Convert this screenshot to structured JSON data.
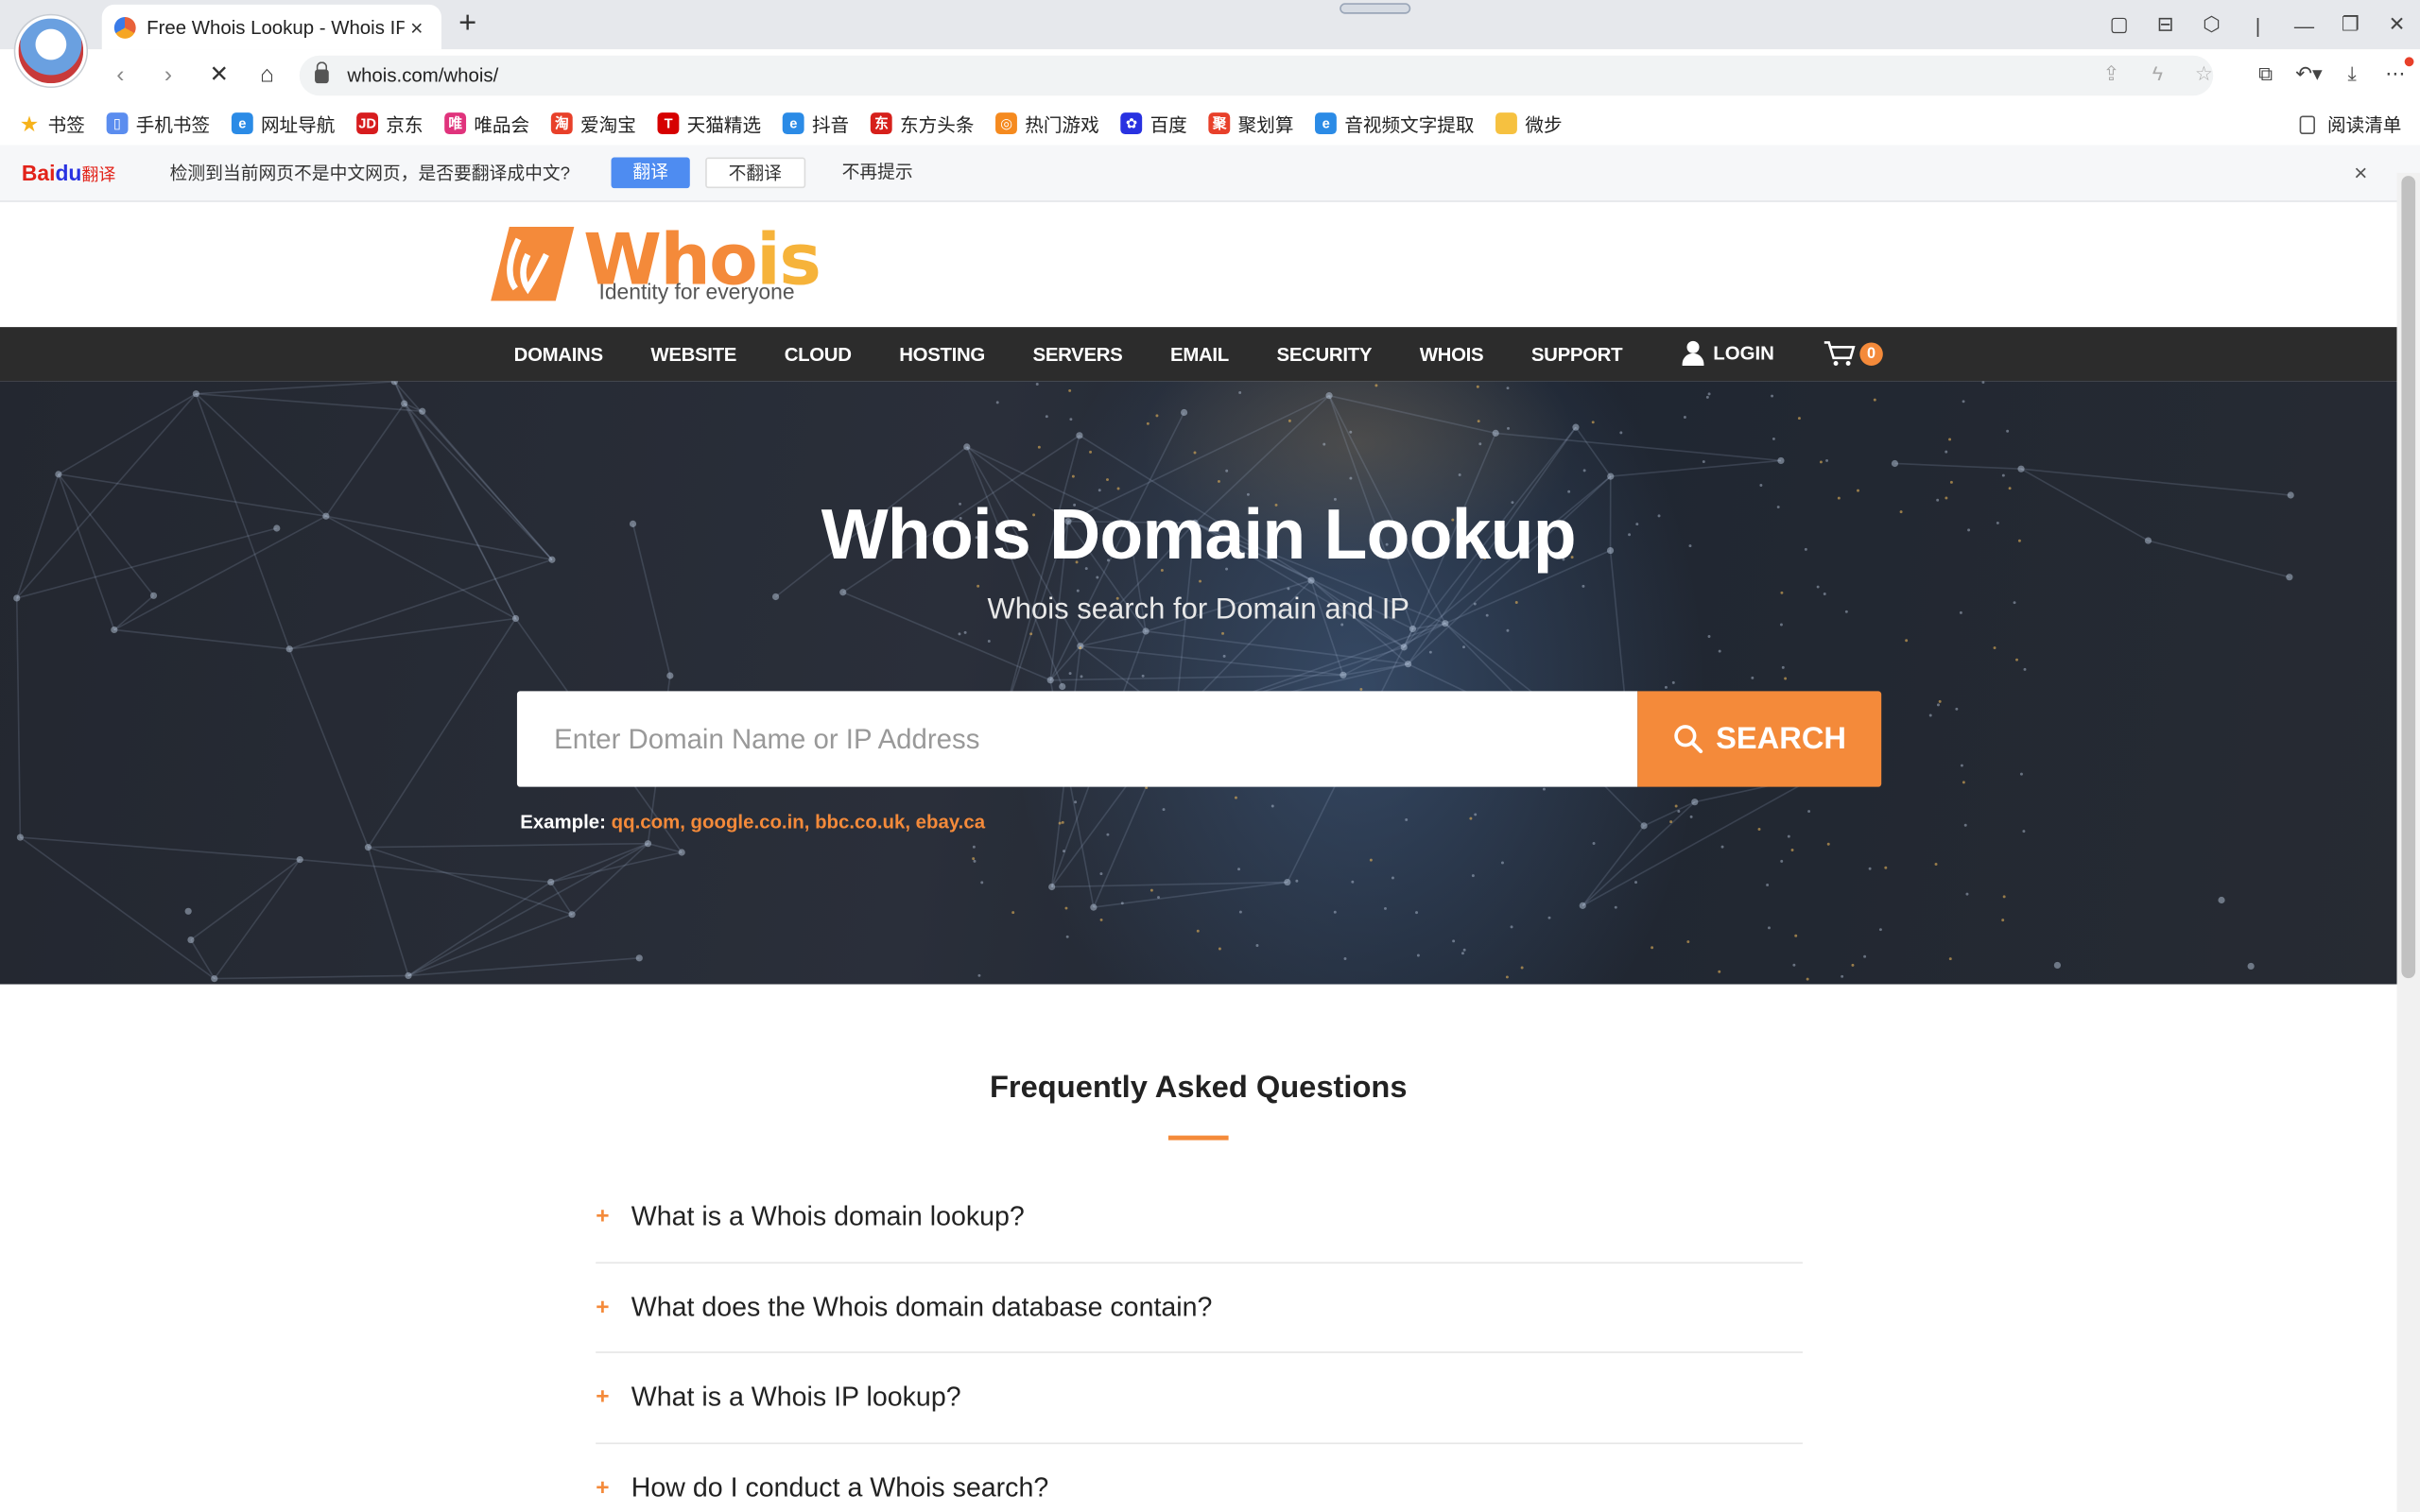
{
  "browser": {
    "tab_title": "Free Whois Lookup - Whois IP",
    "tab_close": "×",
    "new_tab": "+",
    "url": "whois.com/whois/",
    "window_controls": [
      "▢",
      "⊟",
      "⬡",
      "|",
      "—",
      "❐",
      "✕"
    ],
    "addr_tools": [
      "⧉",
      "↶▾",
      "⤓",
      "⋯"
    ],
    "bookmarks": [
      {
        "label": "书签",
        "icon": "star-icon",
        "color": "#f6b21a",
        "glyph": "★"
      },
      {
        "label": "手机书签",
        "icon": "phone-icon",
        "color": "#5b8def",
        "glyph": "▯"
      },
      {
        "label": "网址导航",
        "icon": "e-icon",
        "color": "#2b8be6",
        "glyph": "e"
      },
      {
        "label": "京东",
        "icon": "jd-icon",
        "color": "#d71c1e",
        "glyph": "JD"
      },
      {
        "label": "唯品会",
        "icon": "vip-icon",
        "color": "#e0337c",
        "glyph": "唯"
      },
      {
        "label": "爱淘宝",
        "icon": "taobao-icon",
        "color": "#e8402a",
        "glyph": "淘"
      },
      {
        "label": "天猫精选",
        "icon": "tmall-icon",
        "color": "#d60000",
        "glyph": "T"
      },
      {
        "label": "抖音",
        "icon": "e-icon",
        "color": "#2b8be6",
        "glyph": "e"
      },
      {
        "label": "东方头条",
        "icon": "dongfang-icon",
        "color": "#d6201b",
        "glyph": "东"
      },
      {
        "label": "热门游戏",
        "icon": "game-icon",
        "color": "#f58a1f",
        "glyph": "◎"
      },
      {
        "label": "百度",
        "icon": "baidu-paw-icon",
        "color": "#2932e1",
        "glyph": "✿"
      },
      {
        "label": "聚划算",
        "icon": "juhuasuan-icon",
        "color": "#e8402a",
        "glyph": "聚"
      },
      {
        "label": "音视频文字提取",
        "icon": "e-icon",
        "color": "#2b8be6",
        "glyph": "e"
      },
      {
        "label": "微步",
        "icon": "folder-icon",
        "color": "#f6c140",
        "glyph": ""
      }
    ],
    "reading_list": "阅读清单"
  },
  "translate_bar": {
    "brand_a": "Bai",
    "brand_b": "du",
    "brand_c": "翻译",
    "message": "检测到当前网页不是中文网页，是否要翻译成中文?",
    "translate_btn": "翻译",
    "no_translate_btn": "不翻译",
    "never_btn": "不再提示",
    "close": "×"
  },
  "site": {
    "logo_word_a": "Who",
    "logo_word_b": "is",
    "logo_tagline": "Identity for everyone",
    "nav": [
      "DOMAINS",
      "WEBSITE",
      "CLOUD",
      "HOSTING",
      "SERVERS",
      "EMAIL",
      "SECURITY",
      "WHOIS",
      "SUPPORT"
    ],
    "login": "LOGIN",
    "cart_count": "0",
    "hero_title": "Whois Domain Lookup",
    "hero_subtitle": "Whois search for Domain and IP",
    "search_placeholder": "Enter Domain Name or IP Address",
    "search_btn": "SEARCH",
    "examples_label": "Example:",
    "examples": "qq.com, google.co.in, bbc.co.uk, ebay.ca",
    "faq_title": "Frequently Asked Questions",
    "faq": [
      "What is a Whois domain lookup?",
      "What does the Whois domain database contain?",
      "What is a Whois IP lookup?",
      "How do I conduct a Whois search?"
    ],
    "accent": "#f48a3a",
    "nav_bg": "#2c2c2c"
  }
}
